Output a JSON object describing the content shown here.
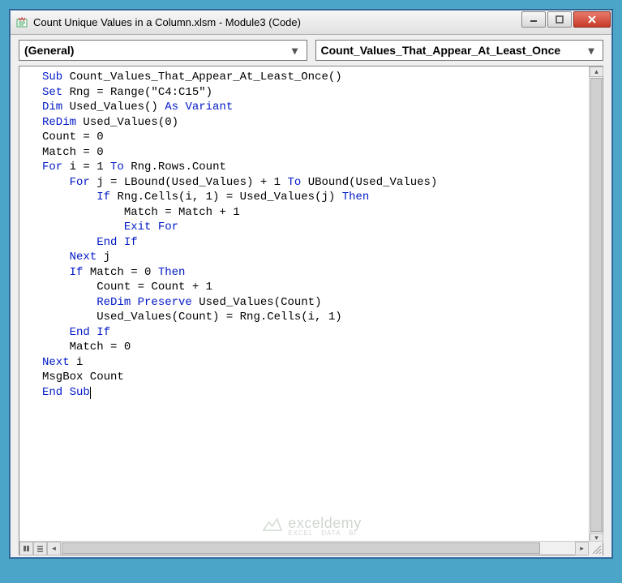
{
  "window": {
    "title": "Count Unique Values in a Column.xlsm - Module3 (Code)"
  },
  "dropdowns": {
    "left": "(General)",
    "right": "Count_Values_That_Appear_At_Least_Once"
  },
  "code": {
    "lines": [
      [
        {
          "t": "Sub ",
          "c": "kw"
        },
        {
          "t": "Count_Values_That_Appear_At_Least_Once()"
        }
      ],
      [
        {
          "t": ""
        }
      ],
      [
        {
          "t": "Set ",
          "c": "kw"
        },
        {
          "t": "Rng = Range(\"C4:C15\")"
        }
      ],
      [
        {
          "t": ""
        }
      ],
      [
        {
          "t": "Dim ",
          "c": "kw"
        },
        {
          "t": "Used_Values() "
        },
        {
          "t": "As Variant",
          "c": "kw"
        }
      ],
      [
        {
          "t": "ReDim ",
          "c": "kw"
        },
        {
          "t": "Used_Values(0)"
        }
      ],
      [
        {
          "t": ""
        }
      ],
      [
        {
          "t": "Count = 0"
        }
      ],
      [
        {
          "t": ""
        }
      ],
      [
        {
          "t": "Match = 0"
        }
      ],
      [
        {
          "t": "For ",
          "c": "kw"
        },
        {
          "t": "i = 1 "
        },
        {
          "t": "To ",
          "c": "kw"
        },
        {
          "t": "Rng.Rows.Count"
        }
      ],
      [
        {
          "t": "    "
        },
        {
          "t": "For ",
          "c": "kw"
        },
        {
          "t": "j = LBound(Used_Values) + 1 "
        },
        {
          "t": "To ",
          "c": "kw"
        },
        {
          "t": "UBound(Used_Values)"
        }
      ],
      [
        {
          "t": "        "
        },
        {
          "t": "If ",
          "c": "kw"
        },
        {
          "t": "Rng.Cells(i, 1) = Used_Values(j) "
        },
        {
          "t": "Then",
          "c": "kw"
        }
      ],
      [
        {
          "t": "            Match = Match + 1"
        }
      ],
      [
        {
          "t": "            "
        },
        {
          "t": "Exit For",
          "c": "kw"
        }
      ],
      [
        {
          "t": "        "
        },
        {
          "t": "End If",
          "c": "kw"
        }
      ],
      [
        {
          "t": "    "
        },
        {
          "t": "Next ",
          "c": "kw"
        },
        {
          "t": "j"
        }
      ],
      [
        {
          "t": "    "
        },
        {
          "t": "If ",
          "c": "kw"
        },
        {
          "t": "Match = 0 "
        },
        {
          "t": "Then",
          "c": "kw"
        }
      ],
      [
        {
          "t": "        Count = Count + 1"
        }
      ],
      [
        {
          "t": "        "
        },
        {
          "t": "ReDim Preserve ",
          "c": "kw"
        },
        {
          "t": "Used_Values(Count)"
        }
      ],
      [
        {
          "t": "        Used_Values(Count) = Rng.Cells(i, 1)"
        }
      ],
      [
        {
          "t": "    "
        },
        {
          "t": "End If",
          "c": "kw"
        }
      ],
      [
        {
          "t": "    Match = 0"
        }
      ],
      [
        {
          "t": "Next ",
          "c": "kw"
        },
        {
          "t": "i"
        }
      ],
      [
        {
          "t": ""
        }
      ],
      [
        {
          "t": "MsgBox Count"
        }
      ],
      [
        {
          "t": ""
        }
      ],
      [
        {
          "t": "End Sub",
          "c": "kw",
          "cursor": true
        }
      ]
    ]
  },
  "watermark": {
    "brand": "exceldemy",
    "tagline": "EXCEL · DATA · BI"
  }
}
